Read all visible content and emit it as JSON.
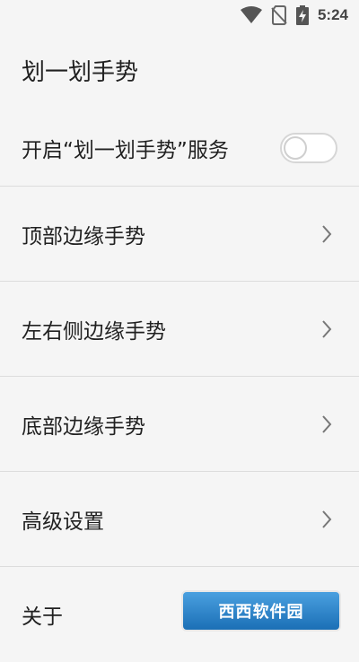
{
  "status_bar": {
    "time": "5:24",
    "icons": [
      "wifi-icon",
      "no-sim-icon",
      "battery-charging-icon"
    ]
  },
  "app_bar": {
    "title": "划一划手势"
  },
  "settings": {
    "service_toggle": {
      "label": "开启“划一划手势”服务",
      "state": "off"
    },
    "items": [
      {
        "label": "顶部边缘手势"
      },
      {
        "label": "左右侧边缘手势"
      },
      {
        "label": "底部边缘手势"
      },
      {
        "label": "高级设置"
      },
      {
        "label": "关于"
      }
    ]
  },
  "watermark": {
    "text": "西西软件园"
  },
  "colors": {
    "background": "#f5f5f5",
    "divider": "#dcdcdc",
    "text_primary": "#212121",
    "icon_gray": "#555555"
  }
}
